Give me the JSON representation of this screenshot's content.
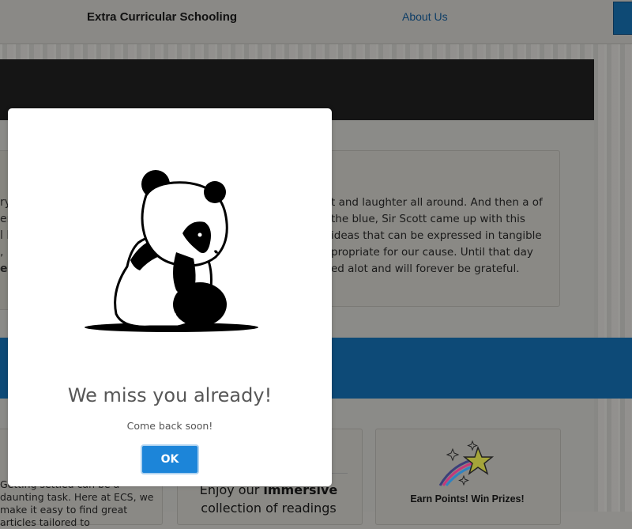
{
  "header": {
    "site_title": "Extra Curricular Schooling",
    "nav_about": "About Us"
  },
  "background": {
    "left_fragments": [
      "ry",
      "en",
      "l h",
      ", .",
      "e"
    ],
    "story_text": "t and laughter all around. And then a of the blue, Sir Scott came up with this ideas that can be expressed in tangible propriate for our cause. Until that day ed alot and will forever be grateful.",
    "card_a_text": "Getting settled can be a daunting task. Here at ECS, we make it easy to find great articles tailored to",
    "card_b_text_prefix": "Enjoy our ",
    "card_b_text_emphasis": "immersive",
    "card_b_text_suffix": "collection of readings",
    "card_c_title": "Earn Points! Win Prizes!"
  },
  "modal": {
    "title": "We miss you already!",
    "message": "Come back soon!",
    "ok_label": "OK",
    "illustration": "sad-panda-icon"
  },
  "colors": {
    "ok_button": "#1c85d9",
    "modal_bg": "#ffffff",
    "overlay_blue_band": "#0d4a77",
    "dark_band": "#151515"
  }
}
